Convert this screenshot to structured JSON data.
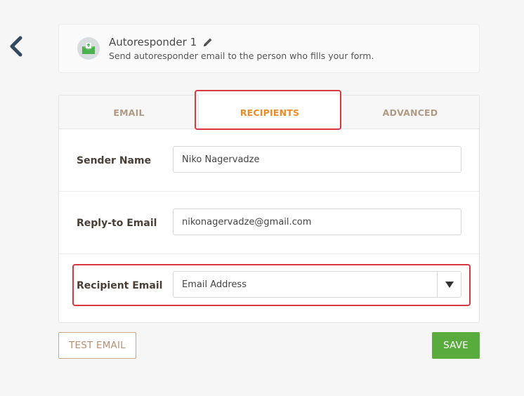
{
  "header": {
    "title": "Autoresponder 1",
    "description": "Send autoresponder email to the person who fills your form.",
    "icon": "envelope-icon",
    "edit_icon": "pencil-icon"
  },
  "nav": {
    "back_icon": "chevron-left-icon"
  },
  "tabs": [
    {
      "label": "EMAIL",
      "active": false
    },
    {
      "label": "RECIPIENTS",
      "active": true
    },
    {
      "label": "ADVANCED",
      "active": false
    }
  ],
  "fields": {
    "sender_name": {
      "label": "Sender Name",
      "value": "Niko Nagervadze"
    },
    "reply_to": {
      "label": "Reply-to Email",
      "value": "nikonagervadze@gmail.com"
    },
    "recipient": {
      "label": "Recipient Email",
      "selected": "Email Address",
      "icon": "caret-down-icon"
    }
  },
  "buttons": {
    "test_email": "TEST EMAIL",
    "save": "SAVE"
  },
  "colors": {
    "accent": "#f08a24",
    "save": "#5aab3d",
    "highlight": "#d9383e",
    "tab_inactive": "#b09a84"
  }
}
